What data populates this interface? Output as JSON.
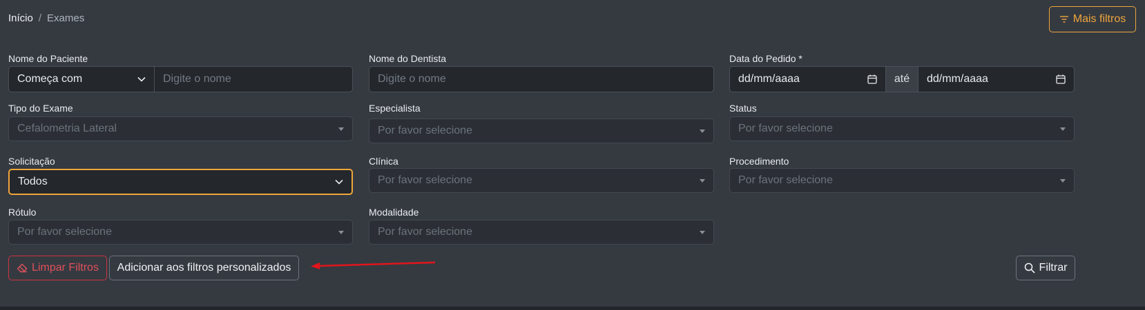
{
  "breadcrumb": {
    "home": "Início",
    "separator": "/",
    "current": "Exames"
  },
  "header": {
    "more_filters_label": "Mais filtros",
    "more_filters_icon": "filter-lines-icon"
  },
  "fields": {
    "patient_name": {
      "label": "Nome do Paciente",
      "match_value": "Começa com",
      "placeholder": "Digite o nome"
    },
    "dentist_name": {
      "label": "Nome do Dentista",
      "placeholder": "Digite o nome"
    },
    "order_date": {
      "label": "Data do Pedido *",
      "from": "dd/mm/aaaa",
      "between": "até",
      "to": "dd/mm/aaaa"
    },
    "exam_type": {
      "label": "Tipo do Exame",
      "value": "Cefalometria Lateral"
    },
    "specialist": {
      "label": "Especialista",
      "placeholder": "Por favor selecione"
    },
    "status": {
      "label": "Status",
      "placeholder": "Por favor selecione"
    },
    "request": {
      "label": "Solicitação",
      "value": "Todos"
    },
    "clinic": {
      "label": "Clínica",
      "placeholder": "Por favor selecione"
    },
    "procedure": {
      "label": "Procedimento",
      "placeholder": "Por favor selecione"
    },
    "tag": {
      "label": "Rótulo",
      "placeholder": "Por favor selecione"
    },
    "modality": {
      "label": "Modalidade",
      "placeholder": "Por favor selecione"
    }
  },
  "actions": {
    "clear_label": "Limpar Filtros",
    "add_custom_label": "Adicionar aos filtros personalizados",
    "filter_label": "Filtrar"
  },
  "colors": {
    "background": "#353a41",
    "accent": "#f0a63a",
    "danger": "#d0343f",
    "annotation_arrow": "#e3141b"
  }
}
